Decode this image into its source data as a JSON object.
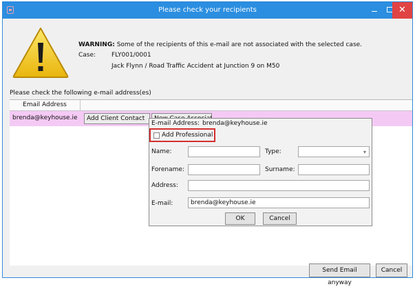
{
  "window": {
    "title": "Please check your recipients"
  },
  "warning": {
    "label": "WARNING:",
    "message": "Some of the recipients of this e-mail are not associated with the selected case.",
    "case_label": "Case:",
    "case_number": "FLY001/0001",
    "case_description": "Jack Flynn / Road Traffic Accident at Junction 9 on M50"
  },
  "instructions": "Please check the following e-mail address(es)",
  "grid": {
    "column_header": "Email Address",
    "rows": [
      {
        "email": "brenda@keyhouse.ie",
        "add_client_contact": "Add Client Contact",
        "new_case_associate": "New Case Associate"
      }
    ]
  },
  "popup": {
    "email_address_label": "E-mail Address:",
    "email_address_value": "brenda@keyhouse.ie",
    "add_professional_label": "Add Professional",
    "add_professional_checked": false,
    "name_label": "Name:",
    "name_value": "",
    "type_label": "Type:",
    "type_value": "",
    "forename_label": "Forename:",
    "forename_value": "",
    "surname_label": "Surname:",
    "surname_value": "",
    "address_label": "Address:",
    "address_value": "",
    "email_label": "E-mail:",
    "email_value": "brenda@keyhouse.ie",
    "ok_label": "OK",
    "cancel_label": "Cancel"
  },
  "footer": {
    "send_label": "Send Email anyway",
    "cancel_label": "Cancel"
  },
  "icons": {
    "app": "app-icon",
    "warning": "warning-triangle-icon",
    "minimize": "minimize-icon",
    "maximize": "maximize-icon",
    "close": "close-icon",
    "dropdown": "chevron-down-icon"
  },
  "colors": {
    "titlebar": "#2b8ee0",
    "close_button": "#e04343",
    "selected_row": "#f4caf5",
    "highlight_border": "#d42f2f",
    "warning_yellow": "#f5d21c"
  }
}
